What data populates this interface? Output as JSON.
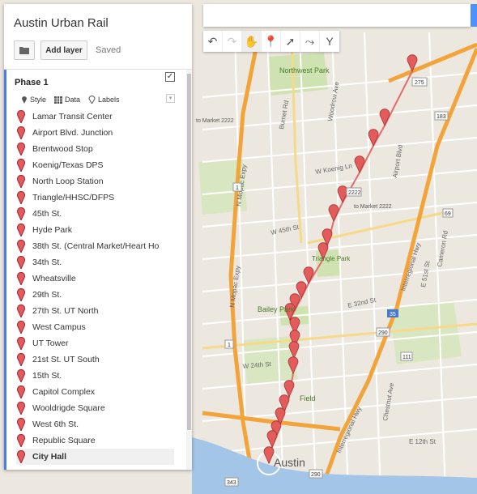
{
  "header": {
    "title": "Austin Urban Rail",
    "add_layer": "Add layer",
    "status": "Saved"
  },
  "layer": {
    "name": "Phase 1",
    "checked": "✓",
    "tools": {
      "style": "Style",
      "data": "Data",
      "labels": "Labels"
    },
    "items": [
      {
        "label": "Lamar Transit Center"
      },
      {
        "label": "Airport Blvd. Junction"
      },
      {
        "label": "Brentwood Stop"
      },
      {
        "label": "Koenig/Texas DPS"
      },
      {
        "label": "North Loop Station"
      },
      {
        "label": "Triangle/HHSC/DFPS"
      },
      {
        "label": "45th St."
      },
      {
        "label": "Hyde Park"
      },
      {
        "label": "38th St. (Central Market/Heart Ho"
      },
      {
        "label": "34th St."
      },
      {
        "label": "Wheatsville"
      },
      {
        "label": "29th St."
      },
      {
        "label": "27th St. UT North"
      },
      {
        "label": "West Campus"
      },
      {
        "label": "UT Tower"
      },
      {
        "label": "21st St. UT South"
      },
      {
        "label": "15th St."
      },
      {
        "label": "Capitol Complex"
      },
      {
        "label": "Wooldrigde Square"
      },
      {
        "label": "West 6th St."
      },
      {
        "label": "Republic Square"
      },
      {
        "label": "City Hall"
      }
    ],
    "selected_index": 21
  },
  "map": {
    "labels": {
      "northwest_park": "Northwest Park",
      "triangle_park": "Triangle Park",
      "bailey_park": "Bailey Park",
      "field": "Field",
      "austin": "Austin",
      "to_market_left": "to Market 2222",
      "to_market_right": "to Market 2222",
      "n_mopac": "N Mopac Expy",
      "n_mopac2": "N Mopac Expy",
      "interregional": "Interregional Hwy",
      "interregional2": "Interregional Hwy",
      "airport_blvd": "Airport Blvd",
      "w_koenig": "W Koenig Ln",
      "w_45th": "W 45th St",
      "w_24th": "W 24th St",
      "e_51st": "E 51st St",
      "e_32nd": "E 32nd St",
      "e_12th": "E 12th St",
      "chestnut": "Chestnut Ave",
      "cameron": "Cameron Rd",
      "burnet": "Burnet Rd",
      "woodrow": "Woodrow Ave"
    },
    "shields": {
      "s275": "275",
      "s183": "183",
      "s1": "1",
      "s1b": "1",
      "s35": "35",
      "s290": "290",
      "s290b": "290",
      "s343": "343",
      "s111": "111",
      "s69": "69",
      "s2222": "2222"
    },
    "toolbar_icons": [
      "undo-icon",
      "redo-icon",
      "hand-icon",
      "marker-icon",
      "line-icon",
      "route-icon",
      "ruler-icon"
    ],
    "colors": {
      "highway": "#f2a33a",
      "water": "#a3c5e8",
      "park": "#c9dfa8",
      "pin": "#e25c5c"
    }
  }
}
